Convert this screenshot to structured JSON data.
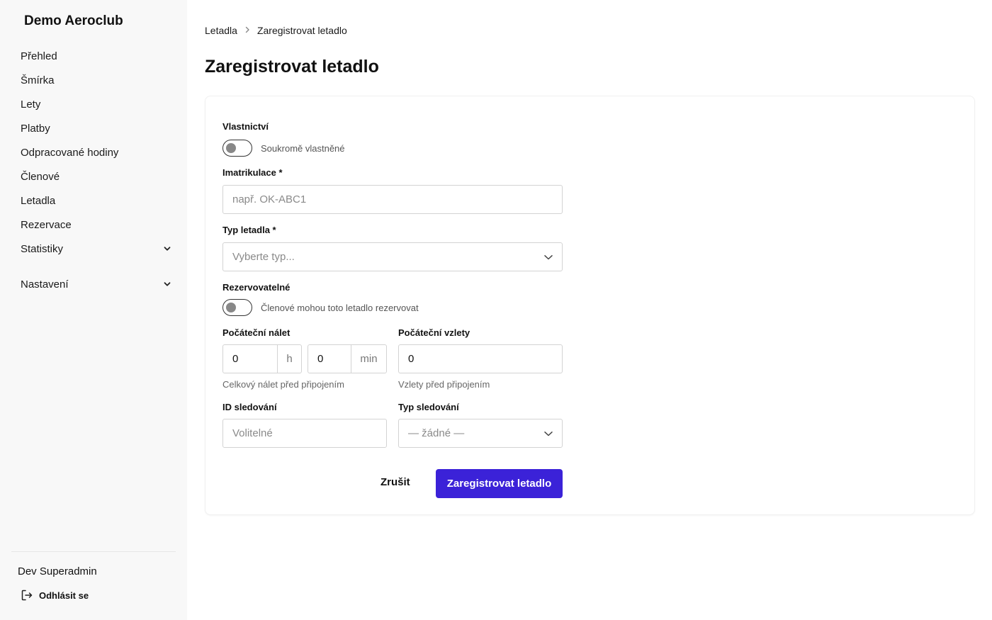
{
  "sidebar": {
    "brand": "Demo Aeroclub",
    "items": [
      {
        "label": "Přehled"
      },
      {
        "label": "Šmírka"
      },
      {
        "label": "Lety"
      },
      {
        "label": "Platby"
      },
      {
        "label": "Odpracované hodiny"
      },
      {
        "label": "Členové"
      },
      {
        "label": "Letadla"
      },
      {
        "label": "Rezervace"
      },
      {
        "label": "Statistiky",
        "icon": "chevron-down-icon"
      },
      {
        "label": "Nastavení",
        "icon": "chevron-down-icon"
      }
    ],
    "user": "Dev Superadmin",
    "logout": "Odhlásit se",
    "logout_icon": "logout-icon"
  },
  "breadcrumb": {
    "parent": "Letadla",
    "current": "Zaregistrovat letadlo",
    "separator_icon": "chevron-right-icon"
  },
  "page": {
    "title": "Zaregistrovat letadlo"
  },
  "form": {
    "ownership": {
      "label": "Vlastnictví",
      "toggle_text": "Soukromě vlastněné",
      "checked": false
    },
    "registration": {
      "label": "Imatrikulace *",
      "value": "",
      "placeholder": "např. OK-ABC1"
    },
    "aircraft_type": {
      "label": "Typ letadla *",
      "value": "Vyberte typ..."
    },
    "reservable": {
      "label": "Rezervovatelné",
      "toggle_text": "Členové mohou toto letadlo rezervovat",
      "checked": false
    },
    "initial_hours": {
      "label": "Počáteční nálet",
      "hours": "0",
      "hours_unit": "h",
      "minutes": "0",
      "minutes_unit": "min",
      "help": "Celkový nálet před připojením"
    },
    "initial_takeoffs": {
      "label": "Počáteční vzlety",
      "value": "0",
      "help": "Vzlety před připojením"
    },
    "tracking_id": {
      "label": "ID sledování",
      "value": "",
      "placeholder": "Volitelné"
    },
    "tracking_type": {
      "label": "Typ sledování",
      "value": "— žádné —"
    },
    "cancel_label": "Zrušit",
    "submit_label": "Zaregistrovat letadlo"
  },
  "colors": {
    "primary": "#3b22d8",
    "sidebar_bg": "#f8f8f8"
  }
}
